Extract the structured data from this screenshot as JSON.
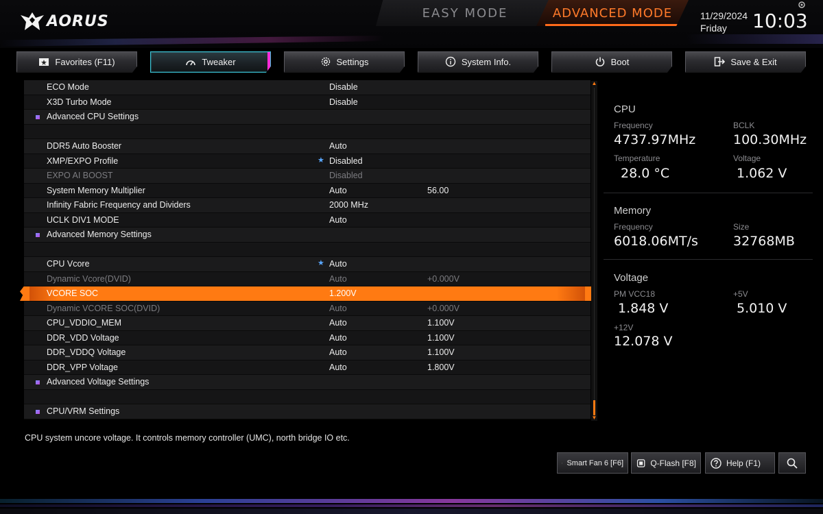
{
  "brand": {
    "logo_text": "AORUS"
  },
  "modes": {
    "easy": "EASY MODE",
    "advanced": "ADVANCED MODE"
  },
  "datetime": {
    "date": "11/29/2024",
    "weekday": "Friday",
    "time": "10:03"
  },
  "tabs": [
    {
      "label": "Favorites (F11)",
      "icon": "favorites-icon"
    },
    {
      "label": "Tweaker",
      "icon": "speedometer-icon",
      "active": true
    },
    {
      "label": "Settings",
      "icon": "gear-icon"
    },
    {
      "label": "System Info.",
      "icon": "info-icon"
    },
    {
      "label": "Boot",
      "icon": "power-icon"
    },
    {
      "label": "Save & Exit",
      "icon": "exit-icon"
    }
  ],
  "rows": [
    {
      "name": "ECO Mode",
      "v1": "Disable",
      "v2": ""
    },
    {
      "name": "X3D Turbo Mode",
      "v1": "Disable",
      "v2": ""
    },
    {
      "name": "Advanced CPU Settings",
      "v1": "",
      "v2": ""
    },
    {
      "name": "",
      "v1": "",
      "v2": ""
    },
    {
      "name": "DDR5 Auto Booster",
      "v1": "Auto",
      "v2": ""
    },
    {
      "name": "XMP/EXPO Profile",
      "v1": "Disabled",
      "v2": ""
    },
    {
      "name": "EXPO AI BOOST",
      "v1": "Disabled",
      "v2": ""
    },
    {
      "name": "System Memory Multiplier",
      "v1": "Auto",
      "v2": "56.00"
    },
    {
      "name": "Infinity Fabric Frequency and Dividers",
      "v1": "2000 MHz",
      "v2": ""
    },
    {
      "name": "UCLK DIV1 MODE",
      "v1": "Auto",
      "v2": ""
    },
    {
      "name": "Advanced Memory Settings",
      "v1": "",
      "v2": ""
    },
    {
      "name": "",
      "v1": "",
      "v2": ""
    },
    {
      "name": "CPU Vcore",
      "v1": "Auto",
      "v2": ""
    },
    {
      "name": "Dynamic Vcore(DVID)",
      "v1": "Auto",
      "v2": "+0.000V"
    },
    {
      "name": "VCORE SOC",
      "v1": "1.200V",
      "v2": ""
    },
    {
      "name": "Dynamic VCORE SOC(DVID)",
      "v1": "Auto",
      "v2": "+0.000V"
    },
    {
      "name": "CPU_VDDIO_MEM",
      "v1": "Auto",
      "v2": "1.100V"
    },
    {
      "name": "DDR_VDD Voltage",
      "v1": "Auto",
      "v2": "1.100V"
    },
    {
      "name": "DDR_VDDQ Voltage",
      "v1": "Auto",
      "v2": "1.100V"
    },
    {
      "name": "DDR_VPP Voltage",
      "v1": "Auto",
      "v2": "1.800V"
    },
    {
      "name": "Advanced Voltage Settings",
      "v1": "",
      "v2": ""
    },
    {
      "name": "",
      "v1": "",
      "v2": ""
    },
    {
      "name": "CPU/VRM Settings",
      "v1": "",
      "v2": ""
    }
  ],
  "panel": {
    "cpu": {
      "title": "CPU",
      "frequency_label": "Frequency",
      "frequency": "4737.97MHz",
      "bclk_label": "BCLK",
      "bclk": "100.30MHz",
      "temperature_label": "Temperature",
      "temperature": "28.0 °C",
      "voltage_label": "Voltage",
      "voltage": "1.062 V"
    },
    "memory": {
      "title": "Memory",
      "frequency_label": "Frequency",
      "frequency": "6018.06MT/s",
      "size_label": "Size",
      "size": "32768MB"
    },
    "voltage": {
      "title": "Voltage",
      "pmvcc18_label": "PM VCC18",
      "pmvcc18": "1.848 V",
      "p5v_label": "+5V",
      "p5v": "5.010 V",
      "p12v_label": "+12V",
      "p12v": "12.078 V"
    }
  },
  "help_text": "CPU system uncore voltage. It controls memory controller (UMC), north bridge IO etc.",
  "bottom_buttons": {
    "smartfan": "Smart Fan 6 [F6]",
    "qflash": "Q-Flash [F8]",
    "help": "Help (F1)"
  },
  "colors": {
    "accent": "#ff7a12",
    "active_tab": "#3dc6d8",
    "tab_edge": "#ff2bd8",
    "star": "#5aa8ff"
  }
}
